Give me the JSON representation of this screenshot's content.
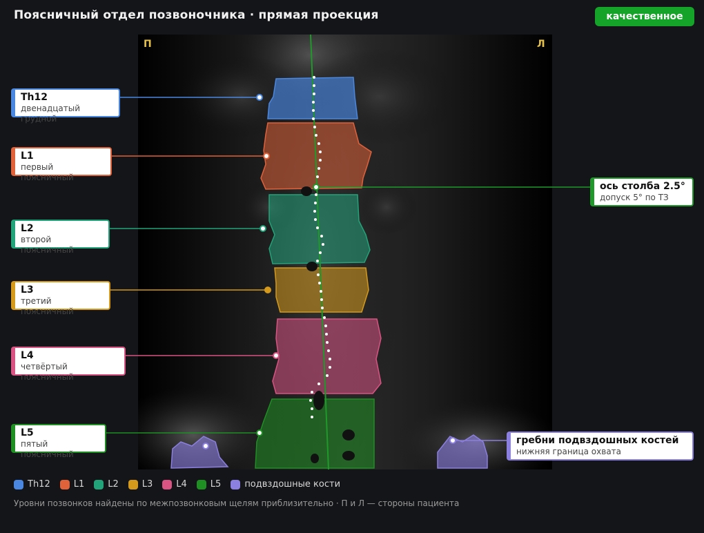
{
  "header": {
    "title": "Поясничный отдел позвоночника · прямая проекция",
    "quality_badge": "качественное"
  },
  "image": {
    "side_right": "П",
    "side_left": "Л"
  },
  "vertebrae": [
    {
      "code": "Th12",
      "name": "двенадцатый грудной",
      "color": "#4a87e0"
    },
    {
      "code": "L1",
      "name": "первый поясничный",
      "color": "#e0623a"
    },
    {
      "code": "L2",
      "name": "второй поясничный",
      "color": "#23a37a"
    },
    {
      "code": "L3",
      "name": "третий поясничный",
      "color": "#d59a1c"
    },
    {
      "code": "L4",
      "name": "четвёртый поясничный",
      "color": "#d95383"
    },
    {
      "code": "L5",
      "name": "пятый поясничный",
      "color": "#1f8f24"
    }
  ],
  "axis_annotation": {
    "title": "ось столба 2.5°",
    "subtitle": "допуск 5° по ТЗ",
    "color": "#1f9a2a"
  },
  "iliac_annotation": {
    "title": "гребни подвздошных костей",
    "subtitle": "нижняя граница охвата",
    "color": "#8b7fe0"
  },
  "legend": [
    {
      "label": "Th12",
      "color": "#4a87e0"
    },
    {
      "label": "L1",
      "color": "#e0623a"
    },
    {
      "label": "L2",
      "color": "#23a37a"
    },
    {
      "label": "L3",
      "color": "#d59a1c"
    },
    {
      "label": "L4",
      "color": "#d95383"
    },
    {
      "label": "L5",
      "color": "#1f8f24"
    },
    {
      "label": "подвздошные кости",
      "color": "#8b7fe0"
    }
  ],
  "footnote": "Уровни позвонков найдены по межпозвонковым щелям приблизительно · П и Л — стороны пациента"
}
